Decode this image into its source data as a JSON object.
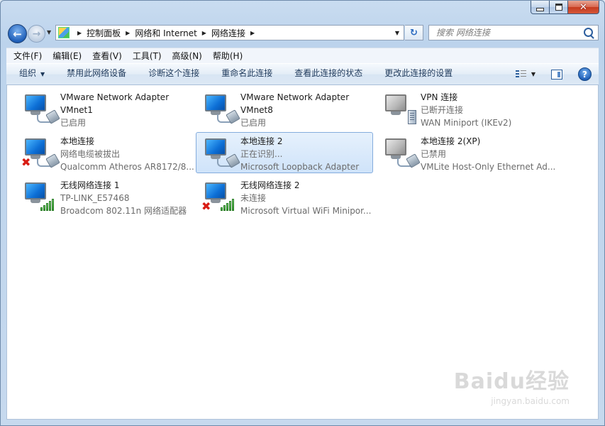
{
  "window": {
    "controls": {
      "minimize": "minimize",
      "maximize": "maximize",
      "close": "✕"
    }
  },
  "address": {
    "crumbs": [
      "控制面板",
      "网络和 Internet",
      "网络连接"
    ],
    "search_placeholder": "搜索 网络连接"
  },
  "menu": [
    "文件(F)",
    "编辑(E)",
    "查看(V)",
    "工具(T)",
    "高级(N)",
    "帮助(H)"
  ],
  "commands": {
    "organize": "组织",
    "items": [
      "禁用此网络设备",
      "诊断这个连接",
      "重命名此连接",
      "查看此连接的状态",
      "更改此连接的设置"
    ]
  },
  "connections": [
    {
      "name": "VMware Network Adapter VMnet1",
      "name_line1": "VMware Network Adapter",
      "name_line2": "VMnet1",
      "status": "已启用",
      "icon": "network-adapter-icon"
    },
    {
      "name": "VMware Network Adapter VMnet8",
      "name_line1": "VMware Network Adapter",
      "name_line2": "VMnet8",
      "status": "已启用",
      "icon": "network-adapter-icon"
    },
    {
      "name": "VPN 连接",
      "status": "已断开连接",
      "device": "WAN Miniport (IKEv2)",
      "icon": "vpn-icon"
    },
    {
      "name": "本地连接",
      "status": "网络电缆被拔出",
      "device": "Qualcomm Atheros AR8172/8...",
      "icon": "network-adapter-disconnected-icon"
    },
    {
      "name": "本地连接 2",
      "status": "正在识别...",
      "device": "Microsoft Loopback Adapter",
      "icon": "network-adapter-icon",
      "selected": true
    },
    {
      "name": "本地连接 2(XP)",
      "status": "已禁用",
      "device": "VMLite Host-Only Ethernet Ad...",
      "icon": "network-adapter-disabled-icon"
    },
    {
      "name": "无线网络连接 1",
      "status": "TP-LINK_E57468",
      "device": "Broadcom 802.11n 网络适配器",
      "icon": "wireless-adapter-icon"
    },
    {
      "name": "无线网络连接 2",
      "status": "未连接",
      "device": "Microsoft Virtual WiFi Minipor...",
      "icon": "wireless-adapter-disconnected-icon"
    }
  ],
  "watermark": {
    "logo": "Baidu经验",
    "url": "jingyan.baidu.com"
  }
}
